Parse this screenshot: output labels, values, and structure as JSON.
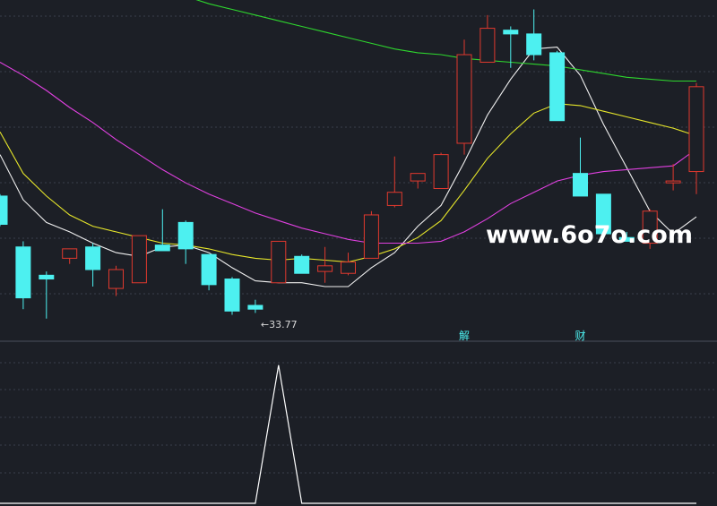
{
  "colors": {
    "background": "#1c1f26",
    "grid": "#3a3f4c",
    "divider": "#4a4f5c",
    "up": "#e0392e",
    "down": "#4df0f0",
    "ma5": "#f0f0f0",
    "ma10": "#e6e62a",
    "ma20": "#e040e0",
    "ma60": "#2ed62e",
    "indicator": "#ffffff",
    "label": "#4df0f0",
    "watermark": "#ffffff"
  },
  "watermark": "www.6o7o.com",
  "low_label": "←33.77",
  "event_labels": [
    "解",
    "财"
  ],
  "chart_data": [
    {
      "type": "candlestick",
      "ylim": [
        32.3,
        50.4
      ],
      "grid": true,
      "x": [
        1,
        2,
        3,
        4,
        5,
        6,
        7,
        8,
        9,
        10,
        11,
        12,
        13,
        14,
        15,
        16,
        17,
        18,
        19,
        20,
        21,
        22,
        23,
        24,
        25,
        26,
        27,
        28,
        29,
        30,
        31
      ],
      "candles": [
        {
          "o": 40.0,
          "h": 40.1,
          "l": 38.4,
          "c": 38.5
        },
        {
          "o": 37.3,
          "h": 37.6,
          "l": 34.0,
          "c": 34.6
        },
        {
          "o": 35.8,
          "h": 36.0,
          "l": 33.5,
          "c": 35.6
        },
        {
          "o": 36.7,
          "h": 37.1,
          "l": 36.4,
          "c": 37.2
        },
        {
          "o": 37.3,
          "h": 37.5,
          "l": 35.2,
          "c": 36.1
        },
        {
          "o": 35.1,
          "h": 36.3,
          "l": 34.7,
          "c": 36.1
        },
        {
          "o": 35.4,
          "h": 37.9,
          "l": 35.4,
          "c": 37.9
        },
        {
          "o": 37.4,
          "h": 39.3,
          "l": 37.1,
          "c": 37.1
        },
        {
          "o": 38.6,
          "h": 38.7,
          "l": 36.4,
          "c": 37.2
        },
        {
          "o": 36.9,
          "h": 36.9,
          "l": 35.0,
          "c": 35.3
        },
        {
          "o": 35.6,
          "h": 35.7,
          "l": 33.7,
          "c": 33.9
        },
        {
          "o": 34.2,
          "h": 34.5,
          "l": 33.8,
          "c": 34.0
        },
        {
          "o": 35.4,
          "h": 37.6,
          "l": 35.4,
          "c": 37.6
        },
        {
          "o": 36.8,
          "h": 36.9,
          "l": 35.9,
          "c": 35.9
        },
        {
          "o": 36.0,
          "h": 37.3,
          "l": 35.4,
          "c": 36.3
        },
        {
          "o": 35.9,
          "h": 37.0,
          "l": 35.8,
          "c": 36.5
        },
        {
          "o": 36.7,
          "h": 39.2,
          "l": 36.7,
          "c": 39.0
        },
        {
          "o": 39.5,
          "h": 42.1,
          "l": 39.4,
          "c": 40.2
        },
        {
          "o": 40.8,
          "h": 41.2,
          "l": 40.4,
          "c": 41.2
        },
        {
          "o": 40.4,
          "h": 42.3,
          "l": 40.4,
          "c": 42.2
        },
        {
          "o": 42.8,
          "h": 48.3,
          "l": 42.2,
          "c": 47.5
        },
        {
          "o": 47.1,
          "h": 49.6,
          "l": 47.1,
          "c": 48.9
        },
        {
          "o": 48.8,
          "h": 49.0,
          "l": 46.8,
          "c": 48.6
        },
        {
          "o": 48.6,
          "h": 49.9,
          "l": 47.2,
          "c": 47.5
        },
        {
          "o": 47.6,
          "h": 47.7,
          "l": 44.0,
          "c": 44.0
        },
        {
          "o": 41.2,
          "h": 43.1,
          "l": 40.0,
          "c": 40.0
        },
        {
          "o": 40.1,
          "h": 40.1,
          "l": 37.9,
          "c": 38.0
        },
        {
          "o": 37.8,
          "h": 38.1,
          "l": 37.6,
          "c": 37.6
        },
        {
          "o": 37.5,
          "h": 39.3,
          "l": 37.2,
          "c": 39.2
        },
        {
          "o": 40.7,
          "h": 41.7,
          "l": 40.3,
          "c": 40.8
        },
        {
          "o": 41.3,
          "h": 46.0,
          "l": 40.1,
          "c": 45.8
        }
      ],
      "series": [
        {
          "name": "MA5",
          "values": [
            42.2,
            39.8,
            38.6,
            38.1,
            37.5,
            37.0,
            36.8,
            37.3,
            37.4,
            37.0,
            36.2,
            35.5,
            35.4,
            35.4,
            35.2,
            35.2,
            36.2,
            37.0,
            38.4,
            39.5,
            41.8,
            44.3,
            46.2,
            47.8,
            47.9,
            46.4,
            43.8,
            41.5,
            39.2,
            38.0,
            38.9
          ]
        },
        {
          "name": "MA10",
          "values": [
            43.4,
            41.2,
            40.0,
            39.0,
            38.4,
            38.1,
            37.8,
            37.5,
            37.4,
            37.2,
            36.9,
            36.7,
            36.6,
            36.7,
            36.6,
            36.5,
            36.8,
            37.2,
            37.8,
            38.7,
            40.3,
            42.0,
            43.3,
            44.4,
            44.9,
            44.8,
            44.5,
            44.2,
            43.9,
            43.6,
            43.2
          ]
        },
        {
          "name": "MA20",
          "values": [
            47.1,
            46.4,
            45.6,
            44.7,
            43.9,
            43.0,
            42.2,
            41.4,
            40.7,
            40.1,
            39.6,
            39.1,
            38.7,
            38.3,
            38.0,
            37.7,
            37.5,
            37.5,
            37.5,
            37.6,
            38.1,
            38.8,
            39.6,
            40.2,
            40.8,
            41.1,
            41.3,
            41.4,
            41.5,
            41.6,
            42.5
          ]
        },
        {
          "name": "MA60",
          "values": [
            54.0,
            53.6,
            53.2,
            52.7,
            52.3,
            51.9,
            51.4,
            51.0,
            50.6,
            50.2,
            49.9,
            49.6,
            49.3,
            49.0,
            48.7,
            48.4,
            48.1,
            47.8,
            47.6,
            47.5,
            47.3,
            47.2,
            47.1,
            47.0,
            46.9,
            46.7,
            46.5,
            46.3,
            46.2,
            46.1,
            46.1
          ]
        }
      ]
    },
    {
      "type": "line",
      "x": [
        1,
        2,
        3,
        4,
        5,
        6,
        7,
        8,
        9,
        10,
        11,
        12,
        13,
        14,
        15,
        16,
        17,
        18,
        19,
        20,
        21,
        22,
        23,
        24,
        25,
        26,
        27,
        28,
        29,
        30,
        31
      ],
      "ylim": [
        0,
        1.05
      ],
      "grid": true,
      "series": [
        {
          "values": [
            0,
            0,
            0,
            0,
            0,
            0,
            0,
            0,
            0,
            0,
            0,
            0,
            1,
            0,
            0,
            0,
            0,
            0,
            0,
            0,
            0,
            0,
            0,
            0,
            0,
            0,
            0,
            0,
            0,
            0,
            0
          ]
        }
      ]
    }
  ]
}
